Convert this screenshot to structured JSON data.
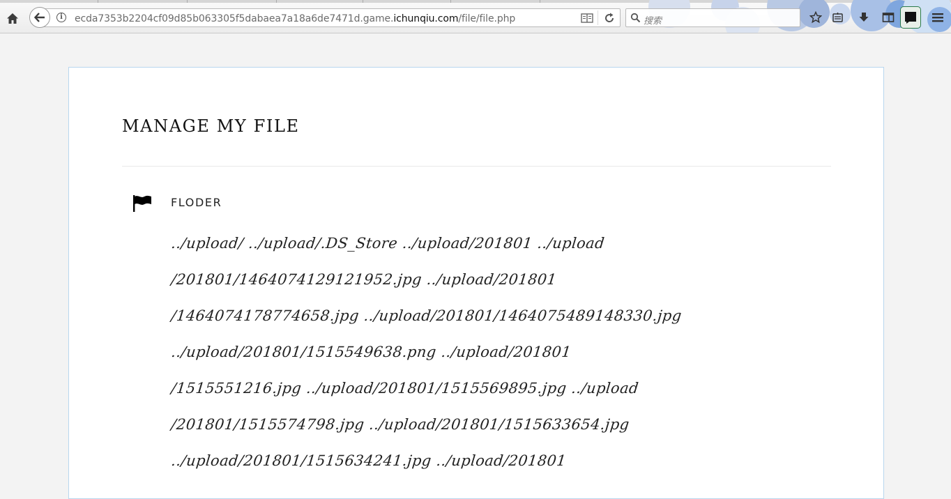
{
  "browser": {
    "url_prefix": "ecda7353b2204cf09d85b063305f5dabaea7a18a6de7471d.game.",
    "url_host": "ichunqiu.com",
    "url_path": "/file/file.php",
    "search_placeholder": "搜索"
  },
  "page": {
    "title": "MANAGE MY FILE",
    "section_label": "FLODER",
    "file_lines": [
      "../upload/ ../upload/.DS_Store ../upload/201801 ../upload",
      "/201801/1464074129121952.jpg ../upload/201801",
      "/1464074178774658.jpg ../upload/201801/1464075489148330.jpg",
      "../upload/201801/1515549638.png ../upload/201801",
      "/1515551216.jpg ../upload/201801/1515569895.jpg ../upload",
      "/201801/1515574798.jpg ../upload/201801/1515633654.jpg",
      "../upload/201801/1515634241.jpg ../upload/201801"
    ]
  }
}
